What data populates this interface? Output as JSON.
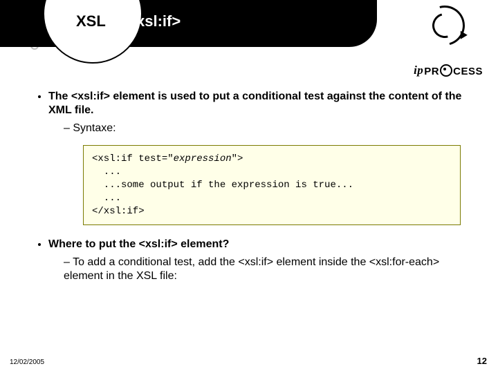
{
  "title_prefix_black": "XSL",
  "title_rest_white": "T - <xsl:if>",
  "brand_ip": "ip",
  "brand_pr": "PR",
  "brand_cess": "CESS",
  "bullet1": "The <xsl:if> element is used to put a conditional test against the content of the XML file.",
  "bullet1_sub": "Syntaxe:",
  "code_l1a": "<xsl:if test=\"",
  "code_l1b": "expression",
  "code_l1c": "\">",
  "code_l2": "  ...",
  "code_l3": "  ...some output if the expression is true...",
  "code_l4": "  ...",
  "code_l5": "</xsl:if>",
  "bullet2": "Where to put the <xsl:if> element?",
  "bullet2_sub": "To add a conditional test, add the <xsl:if> element inside the <xsl:for-each> element in the XSL file:",
  "footer_date": "12/02/2005",
  "footer_page": "12"
}
